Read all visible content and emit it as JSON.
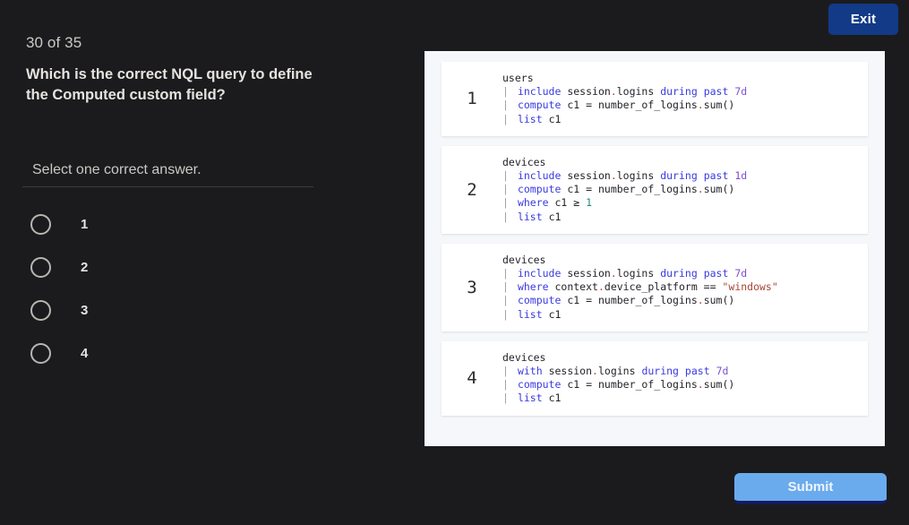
{
  "header": {
    "exit_label": "Exit"
  },
  "quiz": {
    "progress": "30 of 35",
    "question": "Which is the correct NQL query to define the Computed custom field?",
    "instruction": "Select one correct answer.",
    "options": [
      {
        "label": "1",
        "selected": false
      },
      {
        "label": "2",
        "selected": false
      },
      {
        "label": "3",
        "selected": false
      },
      {
        "label": "4",
        "selected": false
      }
    ],
    "submit_label": "Submit"
  },
  "code_options": [
    {
      "number": "1",
      "lines": [
        "users",
        "| include session.logins during past 7d",
        "| compute c1 = number_of_logins.sum()",
        "| list c1"
      ]
    },
    {
      "number": "2",
      "lines": [
        "devices",
        "| include session.logins during past 1d",
        "| compute c1 = number_of_logins.sum()",
        "| where c1 ≥ 1",
        "| list c1"
      ]
    },
    {
      "number": "3",
      "lines": [
        "devices",
        "| include session.logins during past 7d",
        "| where context.device_platform == \"windows\"",
        "| compute c1 = number_of_logins.sum()",
        "| list c1"
      ]
    },
    {
      "number": "4",
      "lines": [
        "devices",
        "| with session.logins during past 7d",
        "| compute c1 = number_of_logins.sum()",
        "| list c1"
      ]
    }
  ],
  "colors": {
    "background": "#1b1b1e",
    "panel": "#f5f7fa",
    "card": "#ffffff",
    "exit_button": "#123a86",
    "submit_button": "#6aabee",
    "submit_shadow": "#151b5e",
    "keyword": "#3a3ae0",
    "number": "#7d4fd1",
    "string": "#a94438",
    "teal": "#1f8a7a"
  }
}
